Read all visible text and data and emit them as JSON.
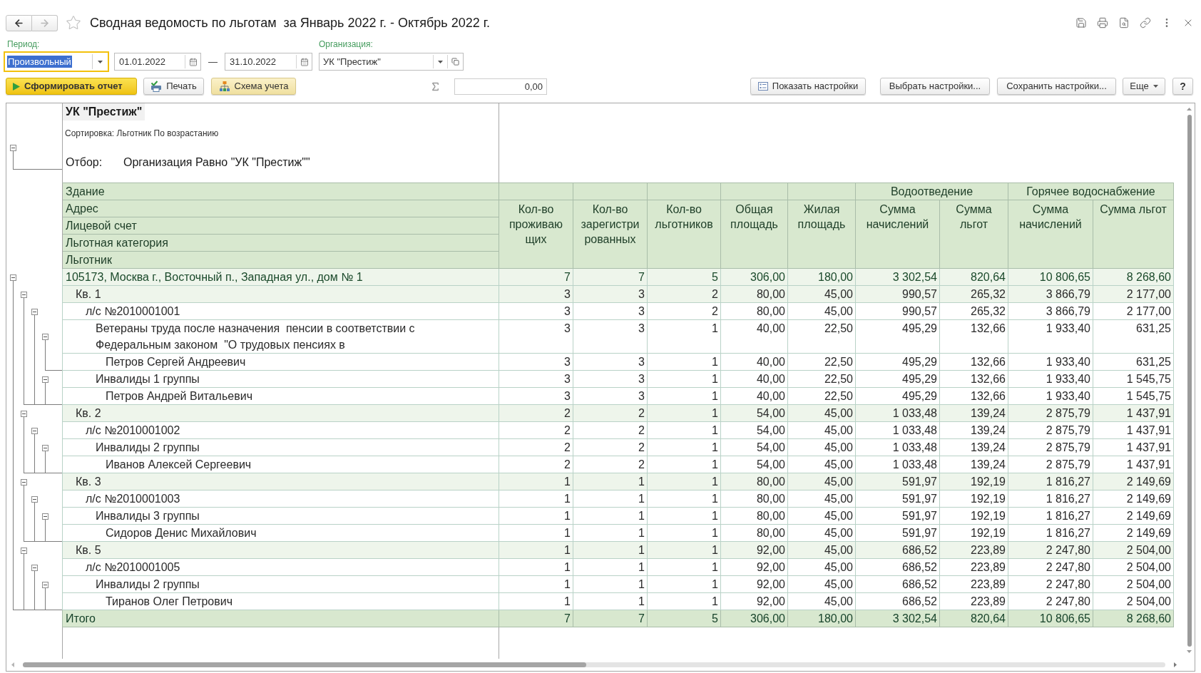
{
  "window": {
    "title": "Сводная ведомость по льготам  за Январь 2022 г. - Октябрь 2022 г.",
    "favorite": false,
    "nav": {
      "back": {
        "disabled": false
      },
      "forward": {
        "disabled": true
      }
    }
  },
  "filters": {
    "period": {
      "label": "Период:",
      "value": "Произвольный",
      "focused": true
    },
    "date_from": "01.01.2022",
    "dash": "—",
    "date_to": "31.10.2022",
    "organization": {
      "label": "Организация:",
      "value": "УК \"Престиж\""
    }
  },
  "toolbar": {
    "generate": "Сформировать отчет",
    "print": "Печать",
    "scheme": "Схема учета",
    "sum": "0,00",
    "show_settings": "Показать настройки",
    "choose_settings": "Выбрать настройки...",
    "save_settings": "Сохранить настройки...",
    "more": "Еще",
    "help": "?"
  },
  "report": {
    "header": {
      "expanded": true,
      "title": "УК \"Престиж\"",
      "sort": "Сортировка: Льготник По возрастанию",
      "filter_label": "Отбор:",
      "filter": "Организация Равно \"УК \"Престиж\"\""
    },
    "tree_columns": [
      "Здание",
      "Адрес",
      "Лицевой счет",
      "Льготная категория",
      "Льготник"
    ],
    "column_groups": [
      {
        "columns": [
          "Кол-во проживающих",
          "Кол-во зарегистрированных",
          "Кол-во льготников",
          "Общая площадь",
          "Жилая площадь"
        ]
      },
      {
        "title": "Водоотведение",
        "columns": [
          "Сумма начислений",
          "Сумма льгот"
        ]
      },
      {
        "title": "Горячее водоснабжение",
        "columns": [
          "Сумма начислений",
          "Сумма льгот"
        ]
      }
    ],
    "rows": [
      {
        "label": "105173, Москва г., Восточный п., Западная ул., дом № 1",
        "values": [
          "7",
          "7",
          "5",
          "306,00",
          "180,00",
          "3 302,54",
          "820,64",
          "10 806,65",
          "8 268,60"
        ],
        "expanded": true,
        "children": [
          {
            "label": "Кв. 1",
            "values": [
              "3",
              "3",
              "2",
              "80,00",
              "45,00",
              "990,57",
              "265,32",
              "3 866,79",
              "2 177,00"
            ],
            "expanded": true,
            "children": [
              {
                "label": "л/с №2010001001",
                "values": [
                  "3",
                  "3",
                  "2",
                  "80,00",
                  "45,00",
                  "990,57",
                  "265,32",
                  "3 866,79",
                  "2 177,00"
                ],
                "expanded": true,
                "children": [
                  {
                    "label": "Ветераны труда после назначения  пенсии в соответствии с Федеральным законом  \"О трудовых пенсиях в",
                    "values": [
                      "3",
                      "3",
                      "1",
                      "40,00",
                      "22,50",
                      "495,29",
                      "132,66",
                      "1 933,40",
                      "631,25"
                    ],
                    "expanded": true,
                    "children": [
                      {
                        "label": "Петров Сергей Андреевич",
                        "values": [
                          "3",
                          "3",
                          "1",
                          "40,00",
                          "22,50",
                          "495,29",
                          "132,66",
                          "1 933,40",
                          "631,25"
                        ]
                      }
                    ]
                  },
                  {
                    "label": "Инвалиды 1 группы",
                    "values": [
                      "3",
                      "3",
                      "1",
                      "40,00",
                      "22,50",
                      "495,29",
                      "132,66",
                      "1 933,40",
                      "1 545,75"
                    ],
                    "expanded": true,
                    "children": [
                      {
                        "label": "Петров Андрей Витальевич",
                        "values": [
                          "3",
                          "3",
                          "1",
                          "40,00",
                          "22,50",
                          "495,29",
                          "132,66",
                          "1 933,40",
                          "1 545,75"
                        ]
                      }
                    ]
                  }
                ]
              }
            ]
          },
          {
            "label": "Кв. 2",
            "values": [
              "2",
              "2",
              "1",
              "54,00",
              "45,00",
              "1 033,48",
              "139,24",
              "2 875,79",
              "1 437,91"
            ],
            "expanded": true,
            "children": [
              {
                "label": "л/с №2010001002",
                "values": [
                  "2",
                  "2",
                  "1",
                  "54,00",
                  "45,00",
                  "1 033,48",
                  "139,24",
                  "2 875,79",
                  "1 437,91"
                ],
                "expanded": true,
                "children": [
                  {
                    "label": "Инвалиды 2 группы",
                    "values": [
                      "2",
                      "2",
                      "1",
                      "54,00",
                      "45,00",
                      "1 033,48",
                      "139,24",
                      "2 875,79",
                      "1 437,91"
                    ],
                    "expanded": true,
                    "children": [
                      {
                        "label": "Иванов Алексей Сергеевич",
                        "values": [
                          "2",
                          "2",
                          "1",
                          "54,00",
                          "45,00",
                          "1 033,48",
                          "139,24",
                          "2 875,79",
                          "1 437,91"
                        ]
                      }
                    ]
                  }
                ]
              }
            ]
          },
          {
            "label": "Кв. 3",
            "values": [
              "1",
              "1",
              "1",
              "80,00",
              "45,00",
              "591,97",
              "192,19",
              "1 816,27",
              "2 149,69"
            ],
            "expanded": true,
            "children": [
              {
                "label": "л/с №2010001003",
                "values": [
                  "1",
                  "1",
                  "1",
                  "80,00",
                  "45,00",
                  "591,97",
                  "192,19",
                  "1 816,27",
                  "2 149,69"
                ],
                "expanded": true,
                "children": [
                  {
                    "label": "Инвалиды 3 группы",
                    "values": [
                      "1",
                      "1",
                      "1",
                      "80,00",
                      "45,00",
                      "591,97",
                      "192,19",
                      "1 816,27",
                      "2 149,69"
                    ],
                    "expanded": true,
                    "children": [
                      {
                        "label": "Сидоров Денис Михайлович",
                        "values": [
                          "1",
                          "1",
                          "1",
                          "80,00",
                          "45,00",
                          "591,97",
                          "192,19",
                          "1 816,27",
                          "2 149,69"
                        ]
                      }
                    ]
                  }
                ]
              }
            ]
          },
          {
            "label": "Кв. 5",
            "values": [
              "1",
              "1",
              "1",
              "92,00",
              "45,00",
              "686,52",
              "223,89",
              "2 247,80",
              "2 504,00"
            ],
            "expanded": true,
            "children": [
              {
                "label": "л/с №2010001005",
                "values": [
                  "1",
                  "1",
                  "1",
                  "92,00",
                  "45,00",
                  "686,52",
                  "223,89",
                  "2 247,80",
                  "2 504,00"
                ],
                "expanded": true,
                "children": [
                  {
                    "label": "Инвалиды 2 группы",
                    "values": [
                      "1",
                      "1",
                      "1",
                      "92,00",
                      "45,00",
                      "686,52",
                      "223,89",
                      "2 247,80",
                      "2 504,00"
                    ],
                    "expanded": true,
                    "children": [
                      {
                        "label": "Тиранов Олег Петрович",
                        "values": [
                          "1",
                          "1",
                          "1",
                          "92,00",
                          "45,00",
                          "686,52",
                          "223,89",
                          "2 247,80",
                          "2 504,00"
                        ]
                      }
                    ]
                  }
                ]
              }
            ]
          }
        ]
      }
    ],
    "total": {
      "label": "Итого",
      "values": [
        "7",
        "7",
        "5",
        "306,00",
        "180,00",
        "3 302,54",
        "820,64",
        "10 806,65",
        "8 268,60"
      ]
    }
  }
}
